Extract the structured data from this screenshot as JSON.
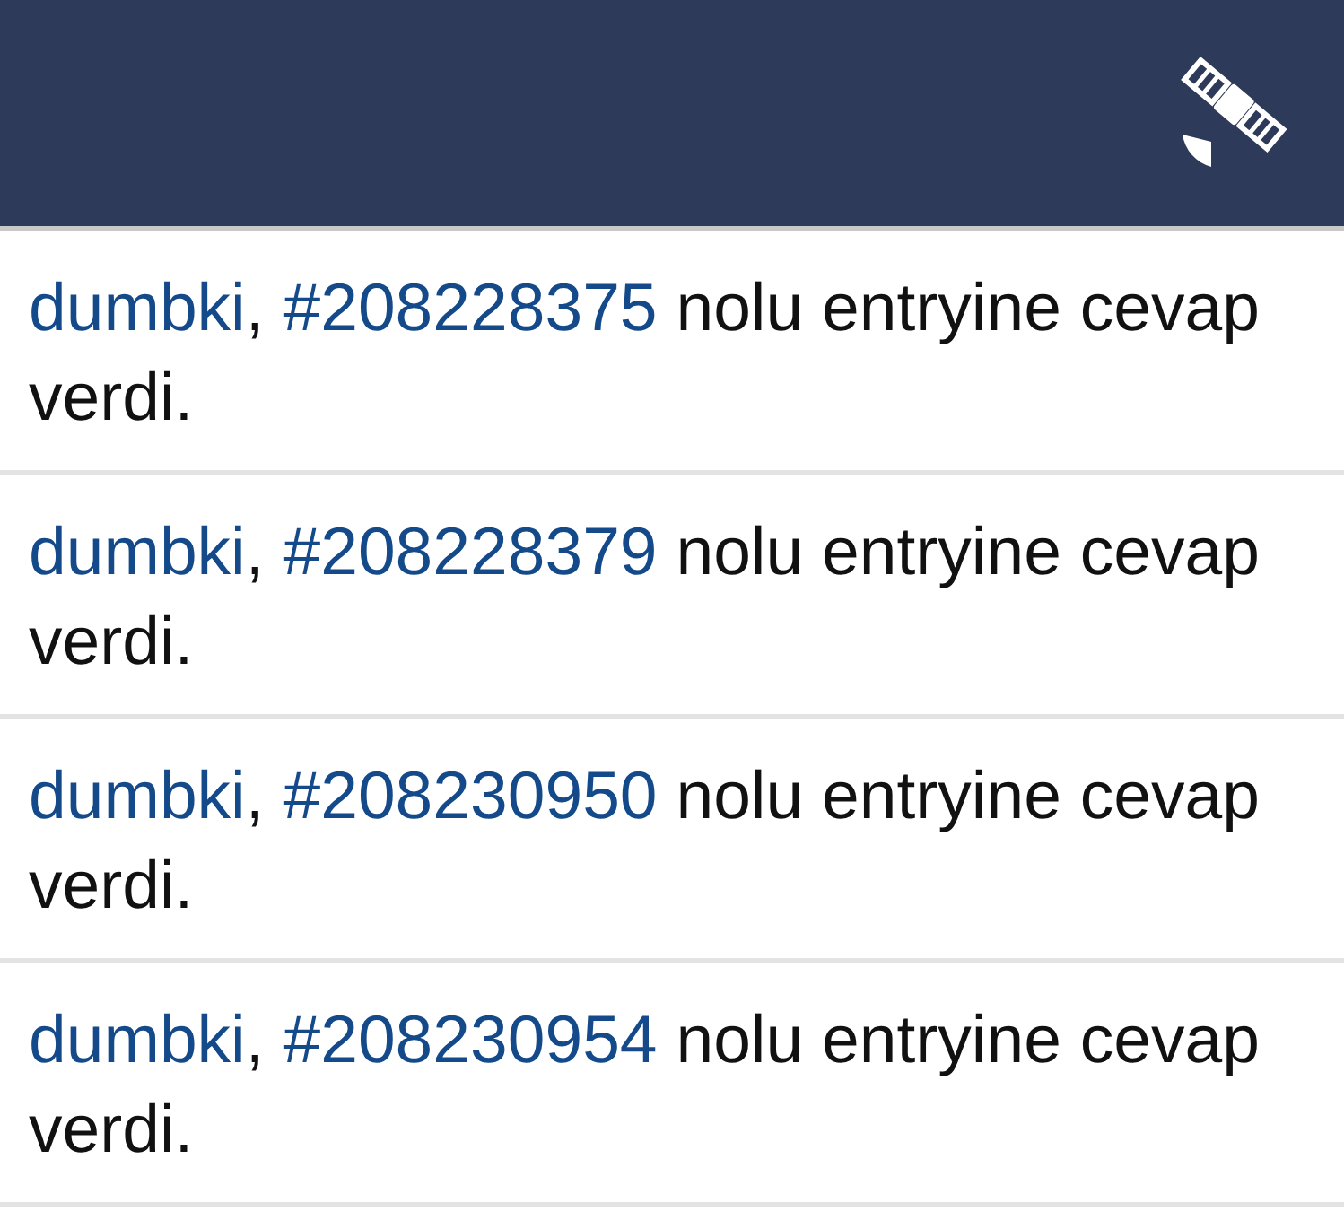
{
  "notifications": [
    {
      "user": "dumbki",
      "separator": ",",
      "entry": "#208228375",
      "text": "nolu entryine cevap verdi."
    },
    {
      "user": "dumbki",
      "separator": ",",
      "entry": "#208228379",
      "text": "nolu entryine cevap verdi."
    },
    {
      "user": "dumbki",
      "separator": ",",
      "entry": "#208230950",
      "text": "nolu entryine cevap verdi."
    },
    {
      "user": "dumbki",
      "separator": ",",
      "entry": "#208230954",
      "text": "nolu entryine cevap verdi."
    }
  ]
}
